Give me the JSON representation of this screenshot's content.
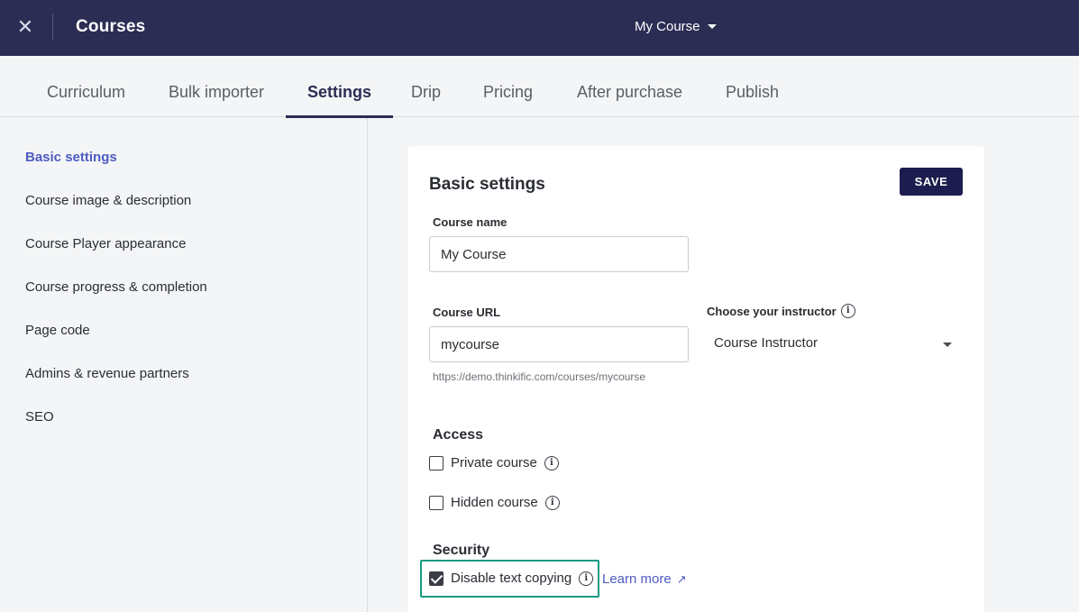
{
  "header": {
    "close_icon": "close-icon",
    "title": "Courses",
    "course_selector": "My Course"
  },
  "tabs": [
    {
      "label": "Curriculum",
      "active": false
    },
    {
      "label": "Bulk importer",
      "active": false
    },
    {
      "label": "Settings",
      "active": true
    },
    {
      "label": "Drip",
      "active": false
    },
    {
      "label": "Pricing",
      "active": false
    },
    {
      "label": "After purchase",
      "active": false
    },
    {
      "label": "Publish",
      "active": false
    }
  ],
  "sidebar": {
    "items": [
      {
        "label": "Basic settings",
        "active": true
      },
      {
        "label": "Course image & description",
        "active": false
      },
      {
        "label": "Course Player appearance",
        "active": false
      },
      {
        "label": "Course progress & completion",
        "active": false
      },
      {
        "label": "Page code",
        "active": false
      },
      {
        "label": "Admins & revenue partners",
        "active": false
      },
      {
        "label": "SEO",
        "active": false
      }
    ]
  },
  "card": {
    "title": "Basic settings",
    "save_label": "SAVE",
    "course_name": {
      "label": "Course name",
      "value": "My Course"
    },
    "course_url": {
      "label": "Course URL",
      "value": "mycourse",
      "hint": "https://demo.thinkific.com/courses/mycourse"
    },
    "instructor": {
      "label": "Choose your instructor",
      "value": "Course Instructor"
    },
    "access": {
      "title": "Access",
      "private": {
        "label": "Private course",
        "checked": false
      },
      "hidden": {
        "label": "Hidden course",
        "checked": false
      }
    },
    "security": {
      "title": "Security",
      "disable_copy": {
        "label": "Disable text copying",
        "checked": true
      },
      "learn_more": "Learn more"
    }
  },
  "colors": {
    "topbar": "#2c2d54",
    "accent_link": "#4d5bc2",
    "save_button": "#1c1d4e",
    "highlight_border": "#1a9a84"
  }
}
